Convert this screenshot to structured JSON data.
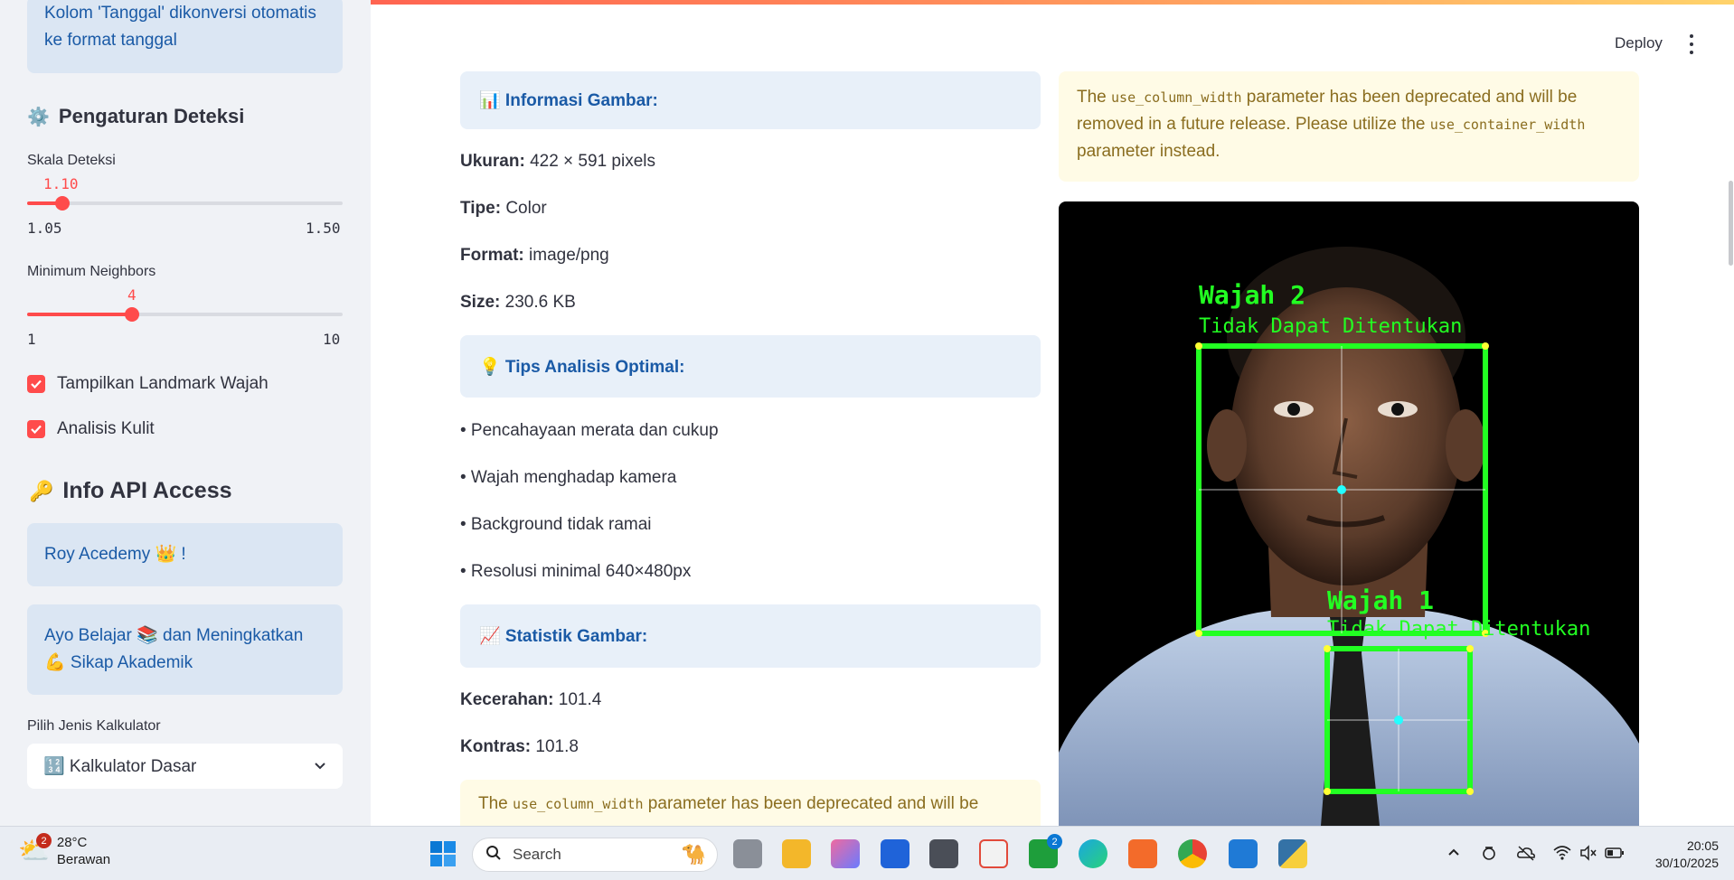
{
  "sidebar": {
    "info_top": "Kolom 'Tanggal' dikonversi otomatis ke format tanggal",
    "detection_heading": "Pengaturan Deteksi",
    "scale": {
      "label": "Skala Deteksi",
      "value": "1.10",
      "min": "1.05",
      "max": "1.50",
      "fraction": 0.111
    },
    "neighbors": {
      "label": "Minimum Neighbors",
      "value": "4",
      "min": "1",
      "max": "10",
      "fraction": 0.333
    },
    "checkboxes": [
      {
        "label": "Tampilkan Landmark Wajah",
        "checked": true
      },
      {
        "label": "Analisis Kulit",
        "checked": true
      }
    ],
    "api_heading": "Info API Access",
    "api_box": "Roy Acedemy 👑 !",
    "motto_box": "Ayo Belajar 📚 dan Meningkatkan 💪 Sikap Akademik",
    "calc_label": "Pilih Jenis Kalkulator",
    "calc_selected": "🔢 Kalkulator Dasar"
  },
  "header": {
    "deploy": "Deploy"
  },
  "main": {
    "info_title": "📊 Informasi Gambar:",
    "info_rows": [
      {
        "key": "Ukuran:",
        "value": "422 × 591 pixels"
      },
      {
        "key": "Tipe:",
        "value": "Color"
      },
      {
        "key": "Format:",
        "value": "image/png"
      },
      {
        "key": "Size:",
        "value": "230.6 KB"
      }
    ],
    "tips_title": "💡 Tips Analisis Optimal:",
    "tips": [
      "• Pencahayaan merata dan cukup",
      "• Wajah menghadap kamera",
      "• Background tidak ramai",
      "• Resolusi minimal 640×480px"
    ],
    "stats_title": "📈 Statistik Gambar:",
    "stats_rows": [
      {
        "key": "Kecerahan:",
        "value": "101.4"
      },
      {
        "key": "Kontras:",
        "value": "101.8"
      }
    ],
    "warn_bottom": {
      "pre": "The ",
      "code": "use_column_width",
      "post": " parameter has been deprecated and will be"
    }
  },
  "right": {
    "warn": {
      "pre": "The ",
      "code1": "use_column_width",
      "mid": " parameter has been deprecated and will be removed in a future release. Please utilize the ",
      "code2": "use_container_width",
      "post": " parameter instead."
    },
    "faces": [
      {
        "title": "Wajah 2",
        "subtitle": "Tidak Dapat Ditentukan"
      },
      {
        "title": "Wajah 1",
        "subtitle": "Tidak Dapat Ditentukan"
      }
    ]
  },
  "taskbar": {
    "weather_temp": "28°C",
    "weather_desc": "Berawan",
    "weather_badge": "2",
    "search_placeholder": "Search",
    "xbox_badge": "2",
    "time": "20:05",
    "date": "30/10/2025"
  },
  "colors": {
    "accent": "#ff4b4b",
    "info_bg": "#e8f0f9",
    "warn_bg": "#fffbe6",
    "detect_green": "#22ff22"
  }
}
